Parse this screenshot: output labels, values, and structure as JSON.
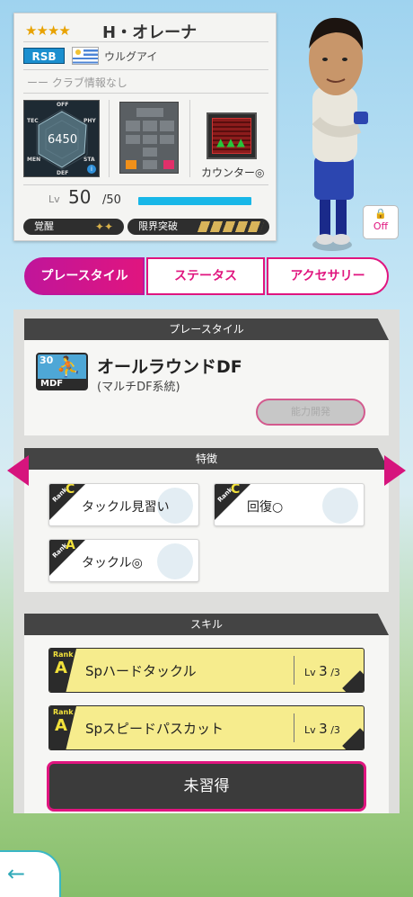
{
  "player": {
    "stars": "★★★★",
    "name": "H・オレーナ",
    "position": "RSB",
    "country": "ウルグアイ",
    "club": "ーー クラブ情報なし",
    "radar": {
      "value": "6450",
      "labels": {
        "off": "OFF",
        "tec": "TEC",
        "phy": "PHY",
        "men": "MEN",
        "sta": "STA",
        "def": "DEF"
      },
      "info_icon": "i"
    },
    "counter_label": "カウンター◎",
    "level_label": "Lv",
    "level": "50",
    "level_max": "/50",
    "awakening_label": "覚醒",
    "awakening_icons": "✦✦",
    "limit_break_label": "限界突破",
    "lock_label": "Off"
  },
  "tabs": [
    {
      "label": "プレースタイル",
      "active": true
    },
    {
      "label": "ステータス",
      "active": false
    },
    {
      "label": "アクセサリー",
      "active": false
    }
  ],
  "playstyle": {
    "header": "プレースタイル",
    "icon_number": "30",
    "icon_code": "MDF",
    "name": "オールラウンドDF",
    "subtitle": "(マルチDF系統)",
    "button": "能力開発"
  },
  "traits": {
    "header": "特徴",
    "items": [
      {
        "rank_text": "Rank",
        "rank": "C",
        "label": "タックル見習い"
      },
      {
        "rank_text": "Rank",
        "rank": "C",
        "label": "回復○"
      },
      {
        "rank_text": "Rank",
        "rank": "A",
        "label": "タックル◎"
      }
    ]
  },
  "skills": {
    "header": "スキル",
    "items": [
      {
        "rank_text": "Rank",
        "rank": "A",
        "name": "Spハードタックル",
        "lv_label": "Lv",
        "lv": "3",
        "lv_max": "/3"
      },
      {
        "rank_text": "Rank",
        "rank": "A",
        "name": "Spスピードパスカット",
        "lv_label": "Lv",
        "lv": "3",
        "lv_max": "/3"
      }
    ],
    "unlearned": "未習得"
  },
  "nav": {
    "back_icon": "←"
  },
  "colors": {
    "accent": "#e0157f",
    "level_bar": "#18b7e8",
    "skill_bg": "#f6ec8d",
    "position_badge": "#1b8fcf"
  }
}
